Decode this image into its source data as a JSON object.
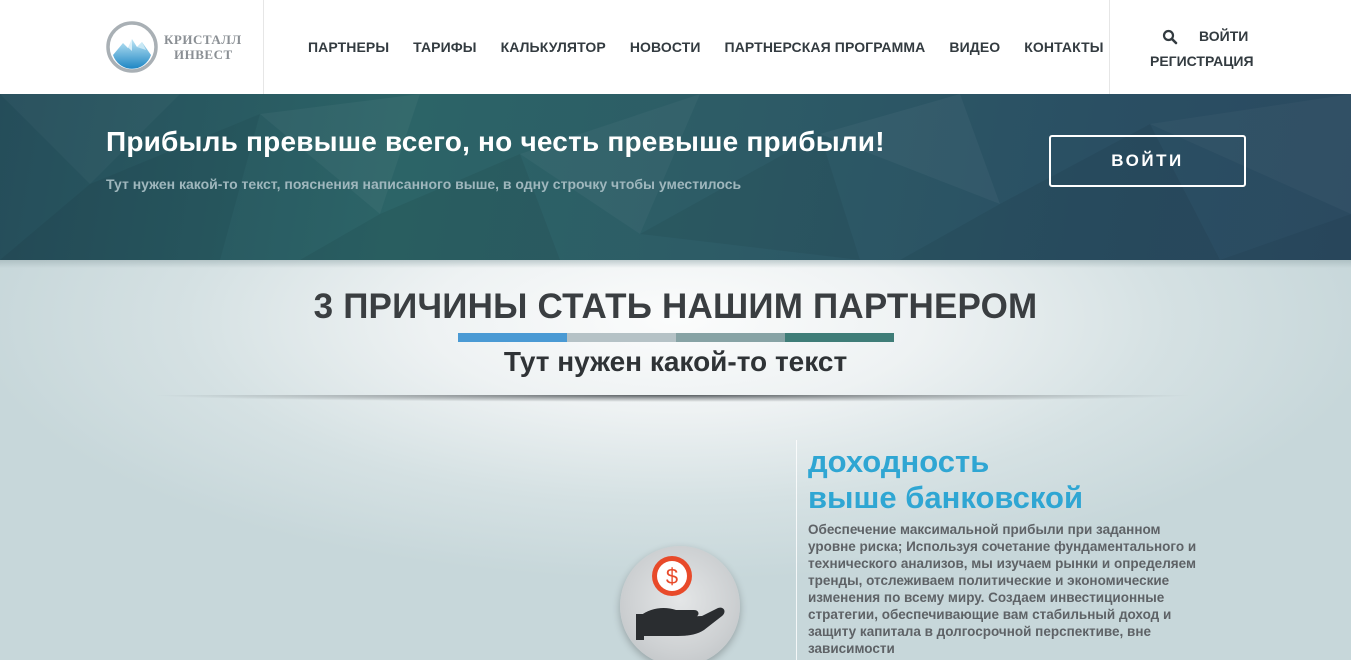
{
  "header": {
    "logo": {
      "line1": "КРИСТАЛЛ",
      "line2": "ИНВЕСТ"
    },
    "nav": [
      {
        "label": "ПАРТНЕРЫ"
      },
      {
        "label": "ТАРИФЫ"
      },
      {
        "label": "КАЛЬКУЛЯТОР"
      },
      {
        "label": "НОВОСТИ"
      },
      {
        "label": "ПАРТНЕРСКАЯ ПРОГРАММА"
      },
      {
        "label": "ВИДЕО"
      },
      {
        "label": "КОНТАКТЫ"
      }
    ],
    "search_icon": "search-icon",
    "login_label": "ВОЙТИ",
    "register_label": "РЕГИСТРАЦИЯ"
  },
  "hero": {
    "title": "Прибыль превыше всего, но честь превыше прибыли!",
    "subtitle": "Тут нужен какой-то текст, пояснения написанного выше, в одну строчку чтобы уместилось",
    "button_label": "ВОЙТИ"
  },
  "section": {
    "title": "3 ПРИЧИНЫ СТАТЬ НАШИМ ПАРТНЕРОМ",
    "subtitle": "Тут нужен какой-то текст",
    "bar_colors": [
      "#4a9ad4",
      "#b5c2c6",
      "#87a3a5",
      "#3f7d78"
    ]
  },
  "feature": {
    "title_line1": "доходность",
    "title_line2": "выше банковской",
    "text": "Обеспечение максимальной прибыли при заданном уровне риска; Используя сочетание фундаментального и технического анализов, мы изучаем рынки и определяем тренды, отслеживаем политические и экономические изменения по всему миру. Создаем инвестиционные стратегии, обеспечивающие вам стабильный доход и защиту капитала в долгосрочной перспективе, вне зависимости",
    "icon": "dollar-hand-icon"
  },
  "colors": {
    "accent_blue": "#2fa6d3",
    "coin_red": "#e84a2a",
    "nav_text": "#333b40"
  }
}
